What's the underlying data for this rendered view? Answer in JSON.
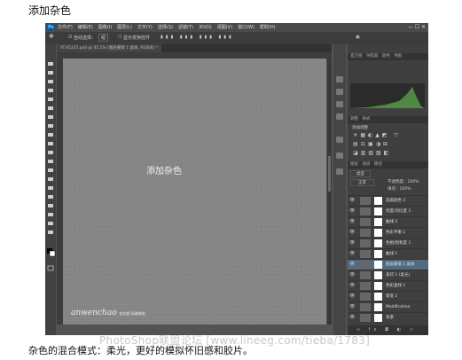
{
  "page": {
    "heading": "添加杂色",
    "caption": "杂色的混合模式：柔光，更好的模拟怀旧感和胶片。",
    "watermark": "PhotoShop联盟论坛 [www.lineeg.com/tieba/1783]"
  },
  "photoshop": {
    "logo": "Ps",
    "menu": [
      "文件(F)",
      "编辑(E)",
      "图像(I)",
      "图层(L)",
      "文字(Y)",
      "选择(S)",
      "滤镜(T)",
      "3D(D)",
      "视图(V)",
      "窗口(W)",
      "帮助(H)"
    ],
    "window_controls": "— ☐ ✕",
    "options": {
      "auto_select": "自动选择：",
      "group": "组",
      "show_transform": "显示变换控件"
    },
    "doc_tab": "YCH5225.psd @ 45.1% (图层蒙版 1 副本, RGB/8) *",
    "canvas_text": "添加杂色",
    "canvas_logo_main": "anwenchao",
    "canvas_logo_sub": "安文超 高端修图",
    "panels": {
      "top_tabs": [
        "直方图",
        "导航器",
        "颜色",
        "色板"
      ],
      "adj_tabs": [
        "调整",
        "样式"
      ],
      "adj_title": "添加调整",
      "layers_tabs": [
        "图层",
        "通道",
        "路径"
      ],
      "kind": "类型",
      "blend_mode": "正常",
      "opacity": "不透明度：100%",
      "fill": "填充：100%"
    },
    "layers": [
      {
        "name": "选取颜色 2",
        "selected": false
      },
      {
        "name": "亮度/对比度 1",
        "selected": false
      },
      {
        "name": "曲线 2",
        "selected": false
      },
      {
        "name": "色彩平衡 1",
        "selected": false
      },
      {
        "name": "色相/饱和度 1",
        "selected": false
      },
      {
        "name": "曲线 1",
        "selected": false
      },
      {
        "name": "图层蒙版 1 副本",
        "selected": true
      },
      {
        "name": "盖印 1 (柔光)",
        "selected": false
      },
      {
        "name": "色彩查找 1",
        "selected": false
      },
      {
        "name": "渐变 2",
        "selected": false
      },
      {
        "name": "Modification",
        "selected": false
      },
      {
        "name": "背景",
        "selected": false
      }
    ]
  }
}
